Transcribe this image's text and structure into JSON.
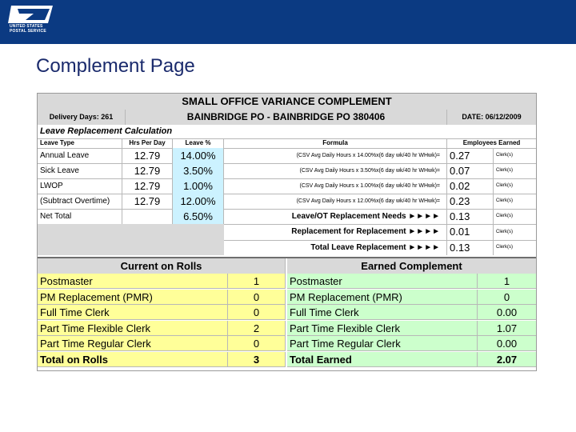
{
  "logo": {
    "text": "UNITED STATES\nPOSTAL SERVICE"
  },
  "page": {
    "title": "Complement Page"
  },
  "colors": {
    "header_bar": "#0b3a82",
    "blue_cells": "#ccf2ff",
    "current_rolls": "#ffff99",
    "earned": "#ccffcc"
  },
  "sheet": {
    "title": "SMALL OFFICE VARIANCE   COMPLEMENT",
    "delivery_days": "Delivery Days: 261",
    "office": "BAINBRIDGE PO - BAINBRIDGE PO   380406",
    "date": "DATE: 06/12/2009",
    "section_title": "Leave Replacement Calculation",
    "columns": {
      "leave_type": "Leave Type",
      "hrs_per_day": "Hrs Per Day",
      "leave_pct": "Leave %",
      "formula": "Formula",
      "employees_earned": "Employees Earned"
    },
    "rows": [
      {
        "type": "Annual Leave",
        "hrs": "12.79",
        "pct": "14.00%",
        "formula": "(CSV Avg Daily Hours x 14.00%x(6 day wk/40 hr WHwk)=",
        "earned": "0.27",
        "unit": "Clerk(s)"
      },
      {
        "type": "Sick Leave",
        "hrs": "12.79",
        "pct": "3.50%",
        "formula": "(CSV Avg Daily Hours x 3.50%x(6 day wk/40 hr WHwk)=",
        "earned": "0.07",
        "unit": "Clerk(s)"
      },
      {
        "type": "LWOP",
        "hrs": "12.79",
        "pct": "1.00%",
        "formula": "(CSV Avg Daily Hours x 1.00%x(6 day wk/40 hr WHwk)=",
        "earned": "0.02",
        "unit": "Clerk(s)"
      },
      {
        "type": "(Subtract Overtime)",
        "hrs": "12.79",
        "pct": "12.00%",
        "formula": "(CSV Avg Daily Hours x 12.00%x(6 day wk/40 hr WHwk)=",
        "earned": "0.23",
        "unit": "Clerk(s)"
      },
      {
        "type": "Net Total",
        "hrs": "",
        "pct": "6.50%",
        "formula": "Leave/OT Replacement Needs  ►►►►",
        "earned": "0.13",
        "unit": "Clerk(s)"
      }
    ],
    "extra_rows": [
      {
        "label": "Replacement for Replacement  ►►►►",
        "earned": "0.01",
        "unit": "Clerk(s)"
      },
      {
        "label": "Total Leave Replacement  ►►►►",
        "earned": "0.13",
        "unit": "Clerk(s)"
      }
    ],
    "current_rolls": {
      "title": "Current on Rolls",
      "items": [
        {
          "label": "Postmaster",
          "value": "1"
        },
        {
          "label": "PM Replacement (PMR)",
          "value": "0"
        },
        {
          "label": "Full Time Clerk",
          "value": "0"
        },
        {
          "label": "Part Time Flexible Clerk",
          "value": "2"
        },
        {
          "label": "Part Time Regular Clerk",
          "value": "0"
        }
      ],
      "total_label": "Total on Rolls",
      "total_value": "3"
    },
    "earned_complement": {
      "title": "Earned Complement",
      "items": [
        {
          "label": "Postmaster",
          "value": "1"
        },
        {
          "label": "PM Replacement (PMR)",
          "value": "0"
        },
        {
          "label": "Full Time Clerk",
          "value": "0.00"
        },
        {
          "label": "Part Time Flexible Clerk",
          "value": "1.07"
        },
        {
          "label": "Part Time Regular Clerk",
          "value": "0.00"
        }
      ],
      "total_label": "Total Earned",
      "total_value": "2.07"
    }
  }
}
